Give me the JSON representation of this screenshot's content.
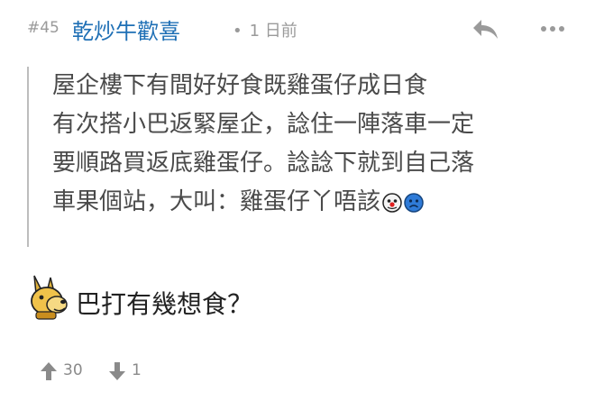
{
  "post": {
    "number": "#45",
    "author": "乾炒牛歡喜",
    "separator": "•",
    "time": "1 日前"
  },
  "quote": {
    "lines": [
      "屋企樓下有間好好食既雞蛋仔成日食",
      "有次搭小巴返緊屋企，諗住一陣落車一定",
      "要順路買返底雞蛋仔。諗諗下就到自己落",
      "車果個站，大叫：雞蛋仔丫唔該"
    ]
  },
  "reply": {
    "text": "巴打有幾想食？"
  },
  "votes": {
    "up": "30",
    "down": "1"
  },
  "icons": {
    "reply": "reply-arrow-icon",
    "more": "more-dots-icon",
    "clown": "clown-emoji-icon",
    "sad": "sad-face-emoji-icon",
    "mascot": "dog-mascot-icon",
    "upvote": "thumbs-up-icon",
    "downvote": "thumbs-down-icon"
  },
  "colors": {
    "author": "#1e6fb5",
    "muted": "#9a9a9a",
    "quote_border": "#bdbdbd",
    "vote": "#8a8a8a"
  }
}
